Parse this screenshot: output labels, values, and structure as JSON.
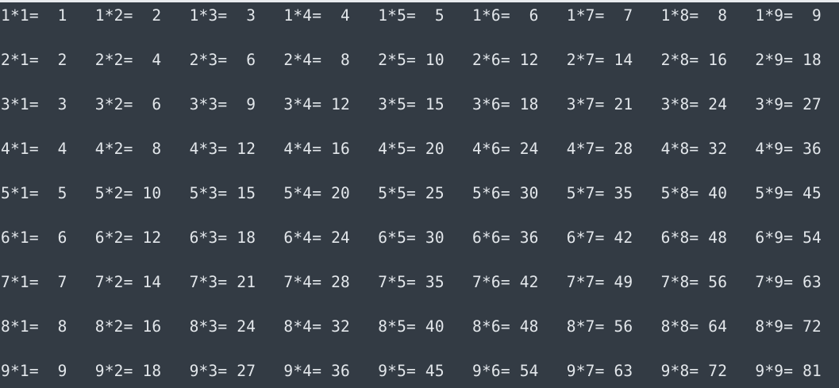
{
  "terminal": {
    "background": "#333b44",
    "text_color": "#e3e7eb",
    "rows": [
      [
        "1*1=  1",
        "1*2=  2",
        "1*3=  3",
        "1*4=  4",
        "1*5=  5",
        "1*6=  6",
        "1*7=  7",
        "1*8=  8",
        "1*9=  9"
      ],
      [
        "2*1=  2",
        "2*2=  4",
        "2*3=  6",
        "2*4=  8",
        "2*5= 10",
        "2*6= 12",
        "2*7= 14",
        "2*8= 16",
        "2*9= 18"
      ],
      [
        "3*1=  3",
        "3*2=  6",
        "3*3=  9",
        "3*4= 12",
        "3*5= 15",
        "3*6= 18",
        "3*7= 21",
        "3*8= 24",
        "3*9= 27"
      ],
      [
        "4*1=  4",
        "4*2=  8",
        "4*3= 12",
        "4*4= 16",
        "4*5= 20",
        "4*6= 24",
        "4*7= 28",
        "4*8= 32",
        "4*9= 36"
      ],
      [
        "5*1=  5",
        "5*2= 10",
        "5*3= 15",
        "5*4= 20",
        "5*5= 25",
        "5*6= 30",
        "5*7= 35",
        "5*8= 40",
        "5*9= 45"
      ],
      [
        "6*1=  6",
        "6*2= 12",
        "6*3= 18",
        "6*4= 24",
        "6*5= 30",
        "6*6= 36",
        "6*7= 42",
        "6*8= 48",
        "6*9= 54"
      ],
      [
        "7*1=  7",
        "7*2= 14",
        "7*3= 21",
        "7*4= 28",
        "7*5= 35",
        "7*6= 42",
        "7*7= 49",
        "7*8= 56",
        "7*9= 63"
      ],
      [
        "8*1=  8",
        "8*2= 16",
        "8*3= 24",
        "8*4= 32",
        "8*5= 40",
        "8*6= 48",
        "8*7= 56",
        "8*8= 64",
        "8*9= 72"
      ],
      [
        "9*1=  9",
        "9*2= 18",
        "9*3= 27",
        "9*4= 36",
        "9*5= 45",
        "9*6= 54",
        "9*7= 63",
        "9*8= 72",
        "9*9= 81"
      ]
    ]
  }
}
